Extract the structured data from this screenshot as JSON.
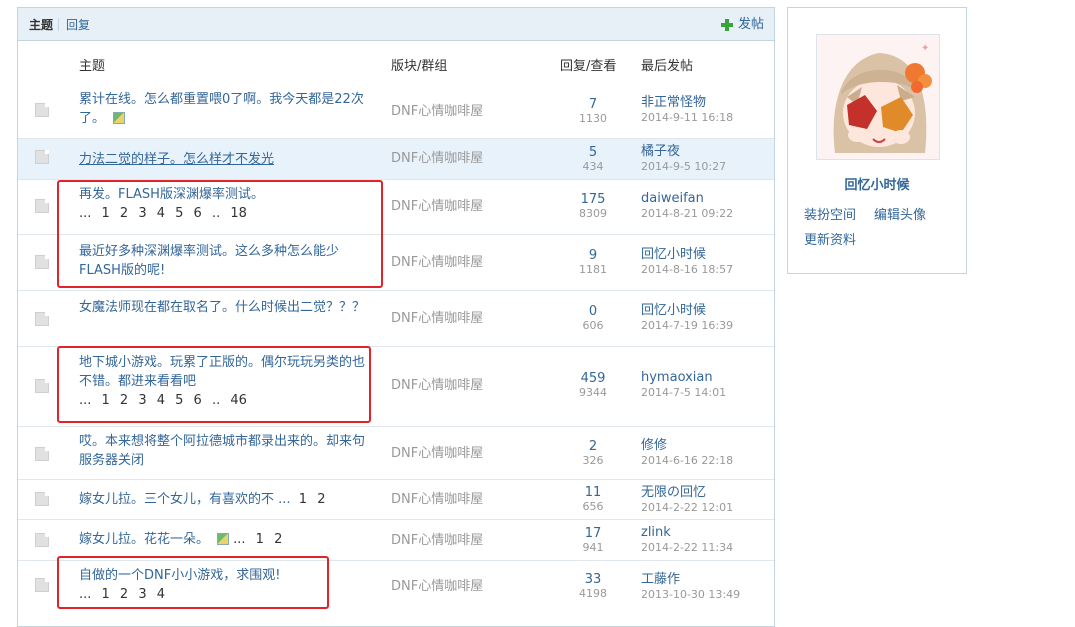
{
  "tabs": {
    "topics": "主题",
    "replies": "回复",
    "new_post": "发帖"
  },
  "columns": {
    "topic": "主题",
    "forum": "版块/群组",
    "stats": "回复/查看",
    "last_post": "最后发帖"
  },
  "rows": [
    {
      "title": "累计在线。怎么都重置喂0了啊。我今天都是22次了。",
      "has_image": true,
      "pages": "",
      "forum": "DNF心情咖啡屋",
      "replies": "7",
      "views": "1130",
      "last_user": "非正常怪物",
      "last_time": "2014-9-11 16:18"
    },
    {
      "title": "力法二觉的样子。怎么样才不发光",
      "has_image": false,
      "pages": "",
      "forum": "DNF心情咖啡屋",
      "replies": "5",
      "views": "434",
      "last_user": "橘子夜",
      "last_time": "2014-9-5 10:27"
    },
    {
      "title": "再发。FLASH版深渊爆率测试。",
      "has_image": false,
      "pages": "... 1 2 3 4 5 6 .. 18",
      "forum": "DNF心情咖啡屋",
      "replies": "175",
      "views": "8309",
      "last_user": "daiweifan",
      "last_time": "2014-8-21 09:22"
    },
    {
      "title": "最近好多种深渊爆率测试。这么多种怎么能少FLASH版的呢!",
      "has_image": false,
      "pages": "",
      "forum": "DNF心情咖啡屋",
      "replies": "9",
      "views": "1181",
      "last_user": "回忆小时候",
      "last_time": "2014-8-16 18:57"
    },
    {
      "title": "女魔法师现在都在取名了。什么时候出二觉？？？",
      "has_image": false,
      "pages": "",
      "forum": "DNF心情咖啡屋",
      "replies": "0",
      "views": "606",
      "last_user": "回忆小时候",
      "last_time": "2014-7-19 16:39"
    },
    {
      "title": "地下城小游戏。玩累了正版的。偶尔玩玩另类的也不错。都进来看看吧",
      "has_image": false,
      "pages": "... 1 2 3 4 5 6 .. 46",
      "forum": "DNF心情咖啡屋",
      "replies": "459",
      "views": "9344",
      "last_user": "hymaoxian",
      "last_time": "2014-7-5 14:01"
    },
    {
      "title": "哎。本来想将整个阿拉德城市都录出来的。却来句服务器关闭",
      "has_image": false,
      "pages": "",
      "forum": "DNF心情咖啡屋",
      "replies": "2",
      "views": "326",
      "last_user": "修修",
      "last_time": "2014-6-16 22:18"
    },
    {
      "title": "嫁女儿拉。三个女儿，有喜欢的不 ...",
      "has_image": false,
      "pages": "1 2",
      "forum": "DNF心情咖啡屋",
      "replies": "11",
      "views": "656",
      "last_user": "无限の回忆",
      "last_time": "2014-2-22 12:01"
    },
    {
      "title": "嫁女儿拉。花花一朵。",
      "has_image": true,
      "pages": "... 1 2",
      "forum": "DNF心情咖啡屋",
      "replies": "17",
      "views": "941",
      "last_user": "zlink",
      "last_time": "2014-2-22 11:34"
    },
    {
      "title": "自做的一个DNF小小游戏，求围观!",
      "has_image": false,
      "pages": "... 1 2 3 4",
      "forum": "DNF心情咖啡屋",
      "replies": "33",
      "views": "4198",
      "last_user": "工藤作",
      "last_time": "2013-10-30 13:49"
    }
  ],
  "profile": {
    "username": "回忆小时候",
    "links": [
      "装扮空间",
      "编辑头像",
      "更新资料"
    ]
  },
  "colors": {
    "link": "#336699",
    "accent_red": "#e0242a",
    "header_bg": "#e8f0f7",
    "border": "#c2d5e3",
    "highlight_row": "#e8f2fb"
  }
}
